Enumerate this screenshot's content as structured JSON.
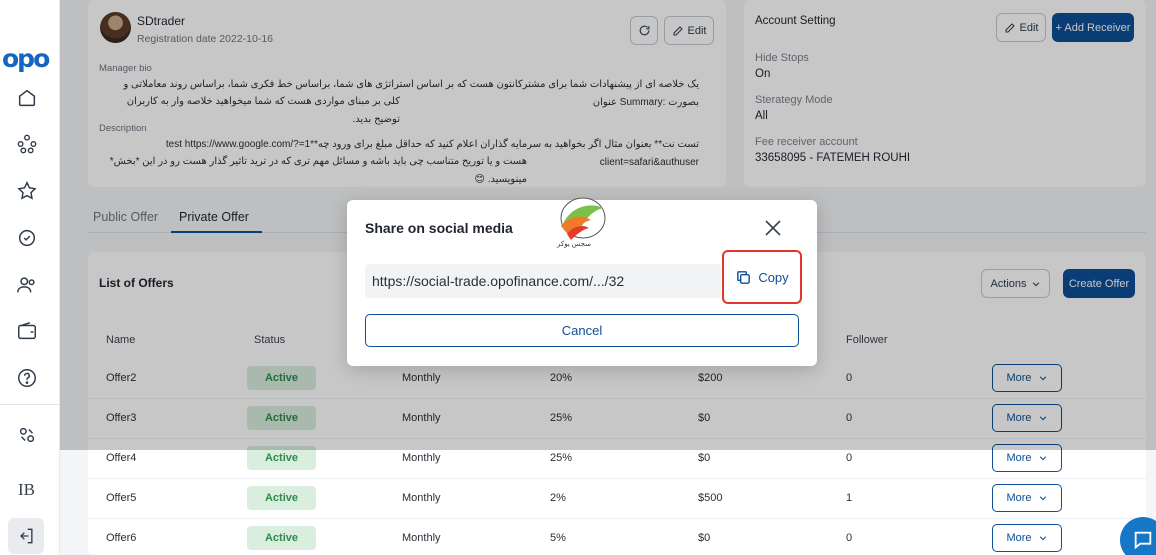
{
  "sidebar": {
    "logo": "opo",
    "icons": [
      "home-icon",
      "network-icon",
      "star-icon",
      "settings-badge-icon",
      "users-icon",
      "wallet-icon",
      "help-icon",
      "community-icon"
    ],
    "ib_label": "IB",
    "logout_icon": "logout-icon"
  },
  "profile": {
    "username": "SDtrader",
    "registration": "Registration date 2022-10-16",
    "edit_label": "Edit",
    "bio_label": "Manager bio",
    "bio_line1": "یک خلاصه ای از پیشنهادات شما برای مشترکانتون هست که بر اساس استراتژی های شما، براساس خط فکری شما، براساس روند معاملاتی و بصورت :Summary عنوان",
    "bio_line2": "کلی بر مبنای مواردی هست که شما میخواهید خلاصه وار به کاربران توضیح بدید.",
    "description_label": "Description",
    "desc_line1": "تست نت** بعنوان مثال اگر بخواهید به سرمایه گذاران اعلام کنید که حداقل مبلغ برای ورود چه**1=test https://www.google.com/?client=safari&authuser",
    "desc_line2": "هست و یا توریح متناسب چی باید باشه و مسائل مهم تری که در ترید تاثیر گذار هست رو در این *بخش* مینویسید. 😊"
  },
  "account": {
    "title": "Account Setting",
    "edit_label": "Edit",
    "add_receiver_label": "+ Add Receiver",
    "hide_stops_label": "Hide Stops",
    "hide_stops_value": "On",
    "strategy_label": "Sterategy Mode",
    "strategy_value": "All",
    "fee_label": "Fee receiver account",
    "fee_value": "33658095 - FATEMEH ROUHI"
  },
  "tabs": [
    {
      "label": "Public Offer",
      "active": false
    },
    {
      "label": "Private Offer",
      "active": true
    }
  ],
  "offers": {
    "title": "List of Offers",
    "actions_label": "Actions",
    "create_label": "Create Offer",
    "columns": {
      "name": "Name",
      "status": "Status",
      "follower": "Follower"
    },
    "rows": [
      {
        "name": "Offer2",
        "status": "Active",
        "period": "Monthly",
        "percent": "20%",
        "amount": "$200",
        "follower": "0",
        "more": "More"
      },
      {
        "name": "Offer3",
        "status": "Active",
        "period": "Monthly",
        "percent": "25%",
        "amount": "$0",
        "follower": "0",
        "more": "More"
      },
      {
        "name": "Offer4",
        "status": "Active",
        "period": "Monthly",
        "percent": "25%",
        "amount": "$0",
        "follower": "0",
        "more": "More"
      },
      {
        "name": "Offer5",
        "status": "Active",
        "period": "Monthly",
        "percent": "2%",
        "amount": "$500",
        "follower": "1",
        "more": "More"
      },
      {
        "name": "Offer6",
        "status": "Active",
        "period": "Monthly",
        "percent": "5%",
        "amount": "$0",
        "follower": "0",
        "more": "More"
      }
    ]
  },
  "modal": {
    "title": "Share on social media",
    "url": "https://social-trade.opofinance.com/.../32",
    "copy_label": "Copy",
    "cancel_label": "Cancel",
    "watermark_text": "سجس یوکر"
  },
  "colors": {
    "primary": "#0d4f97",
    "active_bg": "#d9eedf",
    "active_text": "#2f8a4b",
    "highlight": "#e0362c"
  }
}
